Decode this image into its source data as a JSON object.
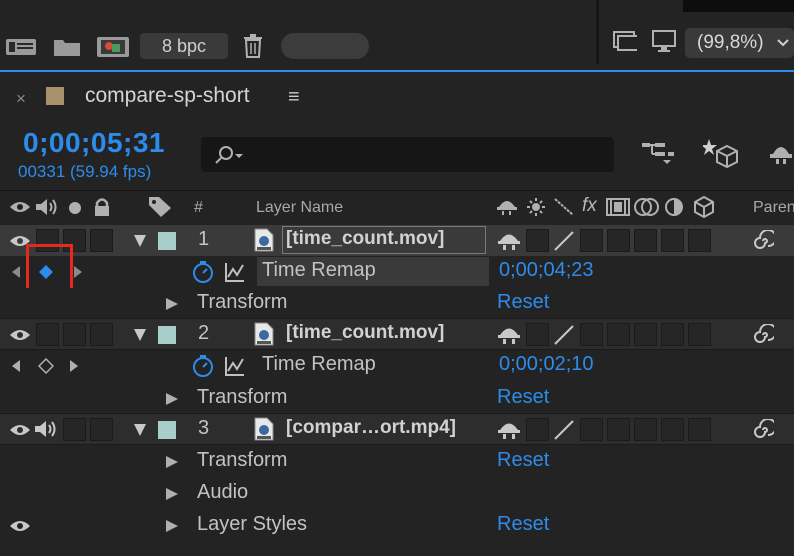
{
  "project_bar": {
    "depth_label": "8 bpc",
    "zoom_label": "(99,8%)",
    "icons": [
      "interpret-footage-icon",
      "new-folder-icon",
      "new-composition-icon",
      "trash-icon",
      "snapshot-icon",
      "monitor-icon",
      "chevron-down-icon"
    ]
  },
  "comp_tab": {
    "close": "×",
    "title": "compare-sp-short",
    "menu": "≡",
    "label_color": "#a6916c"
  },
  "timeline": {
    "timecode": "0;00;05;31",
    "frame_info": "00331 (59.94 fps)",
    "accent_color": "#2d8ceb"
  },
  "header": {
    "number": "#",
    "layer_name": "Layer Name",
    "parent": "Paren",
    "fx": "fx"
  },
  "layers": [
    {
      "number": "1",
      "name": "[time_count.mov]",
      "label_color": "#a9cdc8",
      "selected": true
    },
    {
      "number": "2",
      "name": "[time_count.mov]",
      "label_color": "#a9cdc8"
    },
    {
      "number": "3",
      "name": "[compar…ort.mp4]",
      "label_color": "#a9cdc8"
    }
  ],
  "properties": {
    "l1_time_remap": {
      "label": "Time Remap",
      "value": "0;00;04;23"
    },
    "l1_transform": {
      "label": "Transform",
      "action": "Reset"
    },
    "l2_time_remap": {
      "label": "Time Remap",
      "value": "0;00;02;10"
    },
    "l2_transform": {
      "label": "Transform",
      "action": "Reset"
    },
    "l3_transform": {
      "label": "Transform",
      "action": "Reset"
    },
    "l3_audio": {
      "label": "Audio"
    },
    "l3_layer_styles": {
      "label": "Layer Styles",
      "action": "Reset"
    }
  }
}
